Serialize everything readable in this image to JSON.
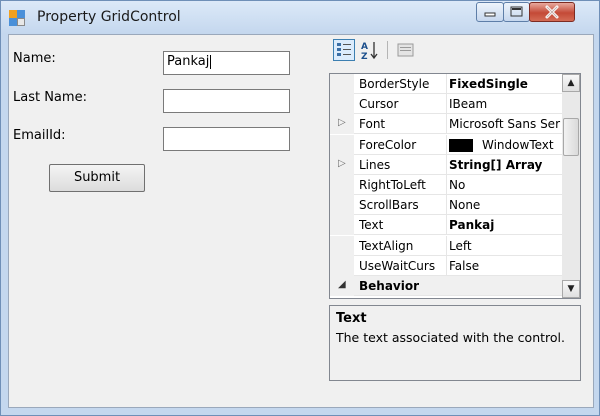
{
  "window": {
    "title": "Property GridControl"
  },
  "form": {
    "name_label": "Name:",
    "name_value": "Pankaj",
    "lastname_label": "Last Name:",
    "lastname_value": "",
    "email_label": "EmailId:",
    "email_value": "",
    "submit_label": "Submit"
  },
  "toolbar": {
    "tools": [
      {
        "icon": "categorized-icon",
        "active": true
      },
      {
        "icon": "alphabetical-sort-icon",
        "active": false
      },
      {
        "icon": "property-pages-icon",
        "active": false
      }
    ]
  },
  "property_grid": {
    "rows": [
      {
        "name": "BorderStyle",
        "value": "FixedSingle",
        "bold": true,
        "expandable": false
      },
      {
        "name": "Cursor",
        "value": "IBeam",
        "bold": false,
        "expandable": false
      },
      {
        "name": "Font",
        "value": "Microsoft Sans Ser",
        "bold": false,
        "expandable": true
      },
      {
        "name": "ForeColor",
        "value": "WindowText",
        "bold": false,
        "expandable": false,
        "swatch": "#000000"
      },
      {
        "name": "Lines",
        "value": "String[] Array",
        "bold": true,
        "expandable": true
      },
      {
        "name": "RightToLeft",
        "value": "No",
        "bold": false,
        "expandable": false
      },
      {
        "name": "ScrollBars",
        "value": "None",
        "bold": false,
        "expandable": false
      },
      {
        "name": "Text",
        "value": "Pankaj",
        "bold": true,
        "expandable": false
      },
      {
        "name": "TextAlign",
        "value": "Left",
        "bold": false,
        "expandable": false
      },
      {
        "name": "UseWaitCurs",
        "value": "False",
        "bold": false,
        "expandable": false
      },
      {
        "name": "Behavior",
        "value": "",
        "category": true
      }
    ]
  },
  "help": {
    "title": "Text",
    "description": "The text associated with the control."
  },
  "colors": {
    "title_bar": "#c4d7ee",
    "close_button": "#c44a37",
    "client_bg": "#f0f0f0"
  }
}
